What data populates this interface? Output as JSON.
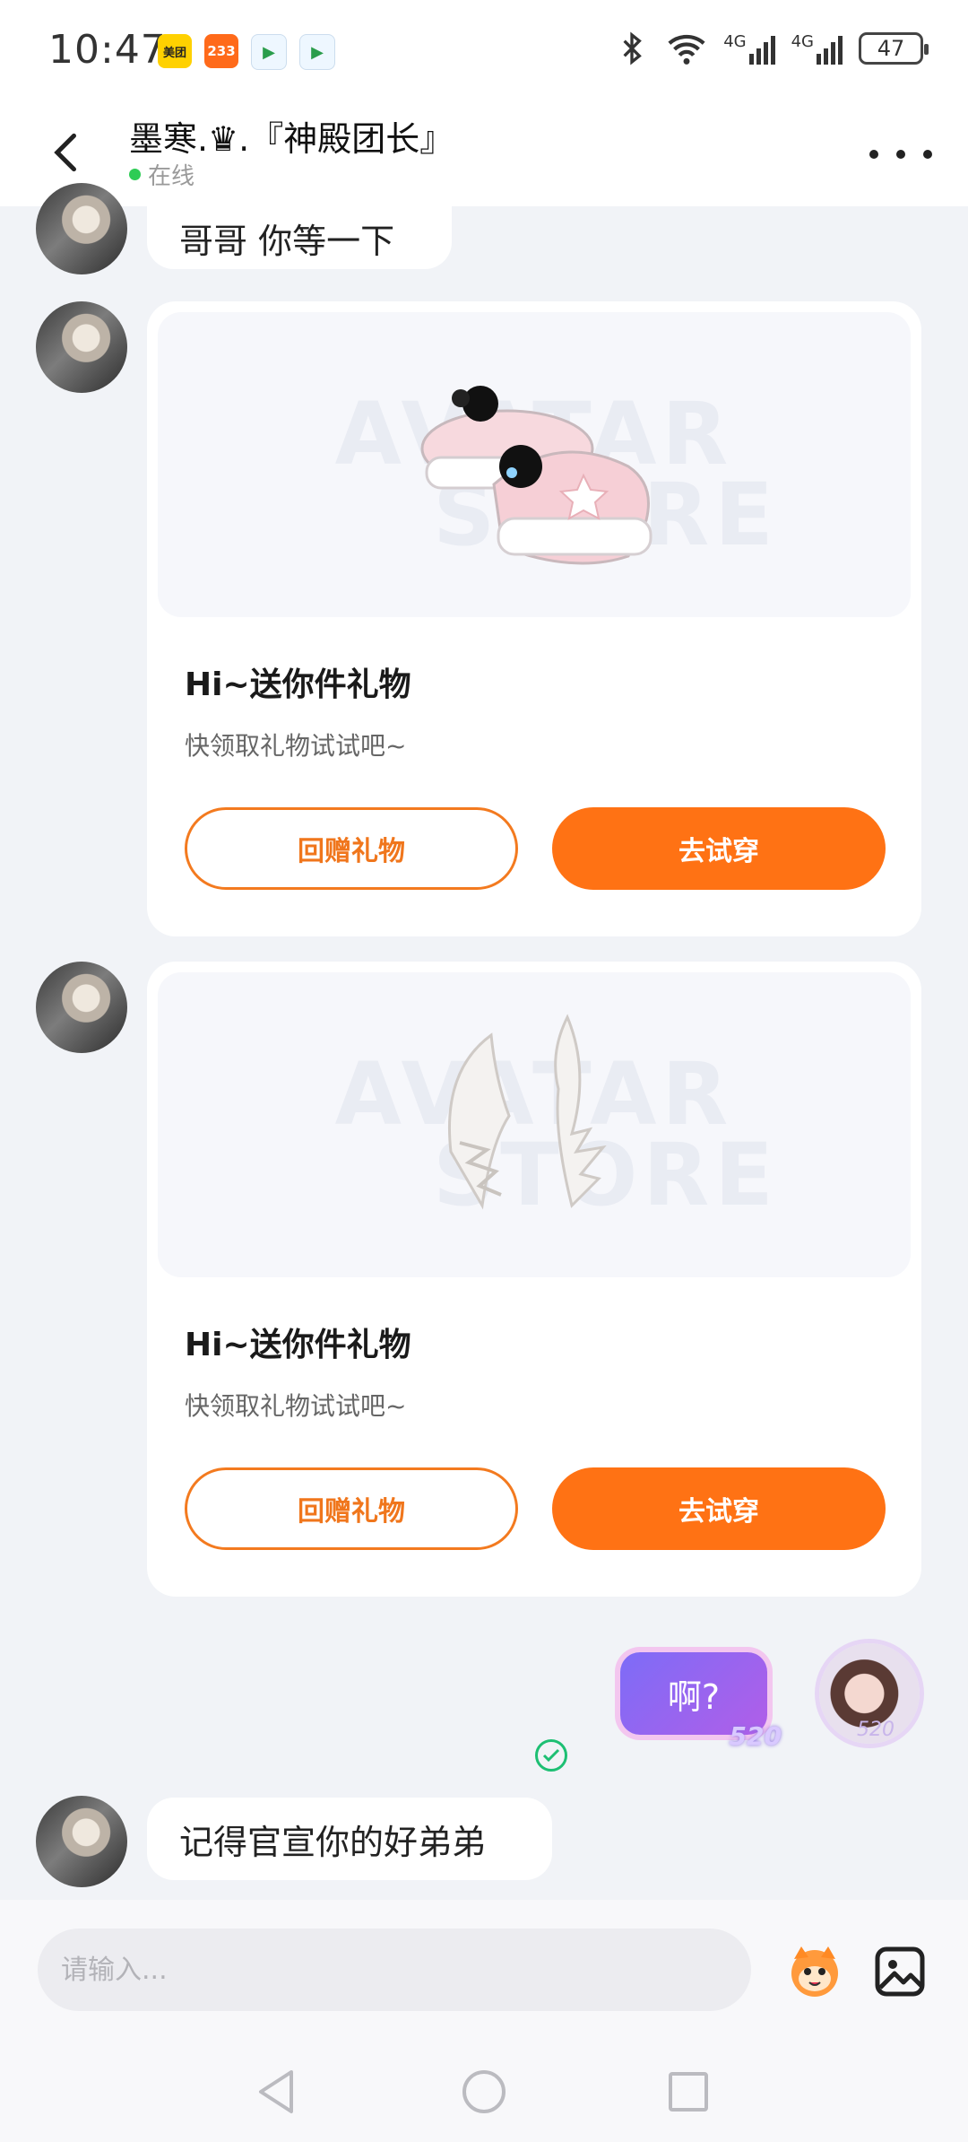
{
  "status_bar": {
    "time": "10:47",
    "apps": [
      "美团",
      "233"
    ],
    "battery": "47",
    "network": "4G"
  },
  "header": {
    "name": "墨寒.♛.『神殿团长』",
    "status": "在线"
  },
  "messages": {
    "text1": "哥哥 你等一下",
    "gift1": {
      "title": "Hi~送你件礼物",
      "subtitle": "快领取礼物试试吧~",
      "return_label": "回赠礼物",
      "try_label": "去试穿"
    },
    "gift2": {
      "title": "Hi~送你件礼物",
      "subtitle": "快领取礼物试试吧~",
      "return_label": "回赠礼物",
      "try_label": "去试穿"
    },
    "my_text": "啊?",
    "my_tag": "520",
    "text2": "记得官宣你的好弟弟"
  },
  "gift_watermark": [
    "AVATAR",
    "STORE"
  ],
  "input": {
    "placeholder": "请输入..."
  },
  "colors": {
    "accent": "#ff7214",
    "online": "#2ecc55",
    "read": "#1dbf73"
  },
  "icons": [
    "back-arrow-icon",
    "more-icon",
    "emoji-icon",
    "image-icon",
    "nav-back-icon",
    "nav-home-icon",
    "nav-recents-icon"
  ]
}
